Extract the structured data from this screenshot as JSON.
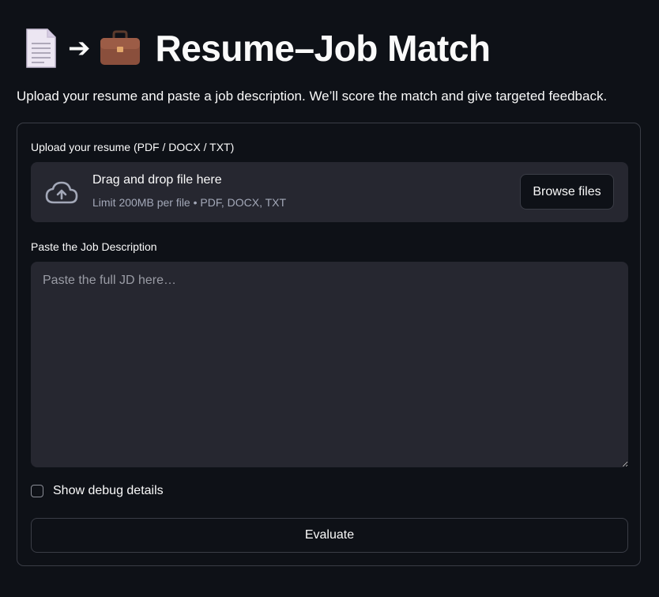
{
  "header": {
    "icon_left": "page-document-icon",
    "arrow": "➔",
    "icon_right": "briefcase-icon",
    "title": "Resume–Job Match"
  },
  "subtitle": "Upload your resume and paste a job description. We’ll score the match and give targeted feedback.",
  "upload": {
    "label": "Upload your resume (PDF / DOCX / TXT)",
    "icon": "cloud-upload-icon",
    "drop_text": "Drag and drop file here",
    "limit_text": "Limit 200MB per file • PDF, DOCX, TXT",
    "browse_label": "Browse files"
  },
  "jd": {
    "label": "Paste the Job Description",
    "placeholder": "Paste the full JD here…",
    "value": ""
  },
  "debug": {
    "label": "Show debug details",
    "checked": false
  },
  "evaluate_label": "Evaluate",
  "colors": {
    "background": "#0e1117",
    "surface": "#262730",
    "border": "#3a3d46",
    "muted_text": "#a3a8b8"
  }
}
